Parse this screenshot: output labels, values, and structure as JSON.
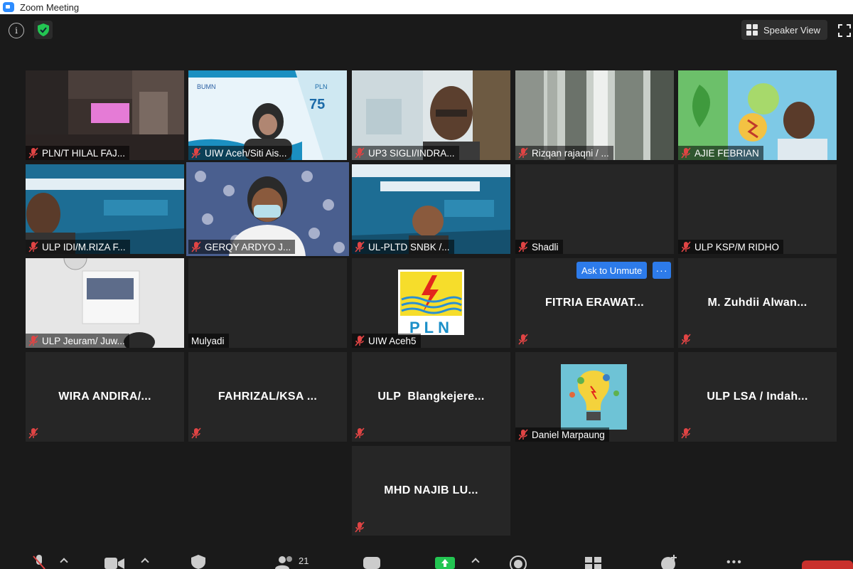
{
  "window": {
    "title": "Zoom Meeting"
  },
  "topbar": {
    "view_label": "Speaker View"
  },
  "colors": {
    "accent_blue": "#2d7bea",
    "active_speaker": "#e8e86a",
    "end_red": "#c9302c",
    "mute_red": "#e04444"
  },
  "tiles": [
    {
      "name": "PLN/T HILAL FAJ...",
      "muted": true,
      "video": "office-room"
    },
    {
      "name": "UIW Aceh/Siti Ais...",
      "muted": true,
      "video": "pln-banner-woman"
    },
    {
      "name": "UP3 SIGLI/INDRA...",
      "muted": true,
      "video": "man-glasses"
    },
    {
      "name": "Rizqan rajaqni / ...",
      "muted": true,
      "video": "curtain-window"
    },
    {
      "name": "AJIE FEBRIAN",
      "muted": true,
      "video": "green-innovative-bg"
    },
    {
      "name": "ULP IDI/M.RIZA F...",
      "muted": true,
      "video": "akhlak-banner-man"
    },
    {
      "name": "GERQY ARDYO J...",
      "muted": true,
      "video": "man-mask-floral",
      "active": true
    },
    {
      "name": "UL-PLTD SNBK /...",
      "muted": true,
      "video": "akhlak-banner-man2"
    },
    {
      "name": "Shadli",
      "muted": true,
      "video": "none"
    },
    {
      "name": "ULP KSP/M RIDHO",
      "muted": true,
      "video": "none"
    },
    {
      "name": "ULP Jeuram/ Juw...",
      "muted": true,
      "video": "whiteboard-room"
    },
    {
      "name": "Mulyadi",
      "muted": false,
      "video": "none"
    },
    {
      "name": "UIW Aceh5",
      "muted": true,
      "video": "pln-logo",
      "logo_text": "PLN"
    },
    {
      "display_name": "FITRIA ERAWAT...",
      "muted": true,
      "video": "none",
      "hover": {
        "ask_unmute_label": "Ask to Unmute",
        "more_label": "···"
      }
    },
    {
      "display_name": "M. Zuhdii Alwan...",
      "muted": true,
      "video": "none"
    },
    {
      "display_name": "WIRA ANDIRA/...",
      "muted": true,
      "video": "none"
    },
    {
      "display_name": "FAHRIZAL/KSA ...",
      "muted": true,
      "video": "none"
    },
    {
      "display_name": "ULP  Blangkejere...",
      "muted": true,
      "video": "none"
    },
    {
      "name": "Daniel Marpaung",
      "muted": true,
      "video": "lightbulb-avatar"
    },
    {
      "display_name": "ULP LSA / Indah...",
      "muted": true,
      "video": "none"
    },
    {
      "display_name": "MHD NAJIB LU...",
      "muted": true,
      "video": "none"
    }
  ],
  "bottombar": {
    "participants_count": "21"
  }
}
